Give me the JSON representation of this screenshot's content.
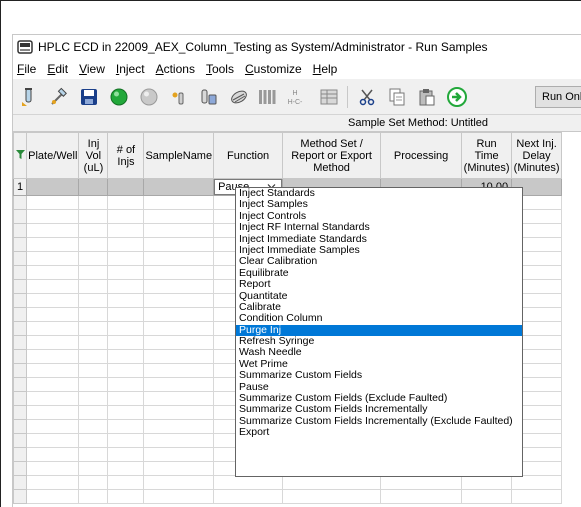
{
  "window": {
    "title": "HPLC ECD in 22009_AEX_Column_Testing as System/Administrator - Run Samples"
  },
  "menu": [
    "File",
    "Edit",
    "View",
    "Inject",
    "Actions",
    "Tools",
    "Customize",
    "Help"
  ],
  "toolbar": {
    "icons": [
      "load-vial-icon",
      "inject-icon",
      "save-icon",
      "start-green-icon",
      "stop-gray-icon",
      "vial-small-icon",
      "vial-stack-icon",
      "calibrate-icon",
      "columns-icon",
      "hc-structure-icon",
      "table-icon",
      "cut-icon",
      "copy-icon",
      "paste-icon",
      "go-icon"
    ],
    "hc_label_top": "H",
    "hc_label_bottom": "H-C-",
    "run_only_label": "Run Only"
  },
  "sample_set": {
    "title": "Sample Set Method: Untitled"
  },
  "table": {
    "headers": [
      "Plate/Well",
      "Inj Vol (uL)",
      "# of Injs",
      "SampleName",
      "Function",
      "Method Set / Report or Export Method",
      "Processing",
      "Run Time (Minutes)",
      "Next Inj. Delay (Minutes)"
    ],
    "row1": {
      "number": "1",
      "function": "Pause",
      "run_time": "10.00"
    }
  },
  "dropdown": {
    "options": [
      "Inject Standards",
      "Inject Samples",
      "Inject Controls",
      "Inject RF Internal Standards",
      "Inject Immediate Standards",
      "Inject Immediate Samples",
      "Clear Calibration",
      "Equilibrate",
      "Report",
      "Quantitate",
      "Calibrate",
      "Condition Column",
      "Purge Inj",
      "Refresh Syringe",
      "Wash Needle",
      "Wet Prime",
      "Summarize Custom Fields",
      "Pause",
      "Summarize Custom Fields (Exclude Faulted)",
      "Summarize Custom Fields Incrementally",
      "Summarize Custom Fields Incrementally (Exclude Faulted)",
      "Export"
    ],
    "selected": "Purge Inj"
  },
  "colors": {
    "selection": "#0078d7",
    "grid_gray": "#c8c8c8",
    "green": "#22a83a"
  }
}
